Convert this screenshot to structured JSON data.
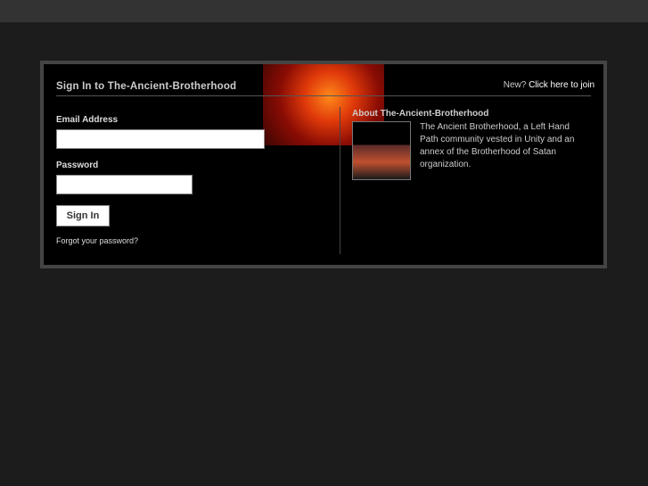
{
  "title": "Sign In to The-Ancient-Brotherhood",
  "join": {
    "prefix": "New?",
    "link": "Click here to join"
  },
  "form": {
    "email_label": "Email Address",
    "email_value": "",
    "password_label": "Password",
    "password_value": "",
    "submit": "Sign In",
    "forgot": "Forgot your password?"
  },
  "about": {
    "heading": "About The-Ancient-Brotherhood",
    "text": "The Ancient Brotherhood, a Left Hand Path community vested in Unity and an annex of the Brotherhood of Satan organization."
  }
}
